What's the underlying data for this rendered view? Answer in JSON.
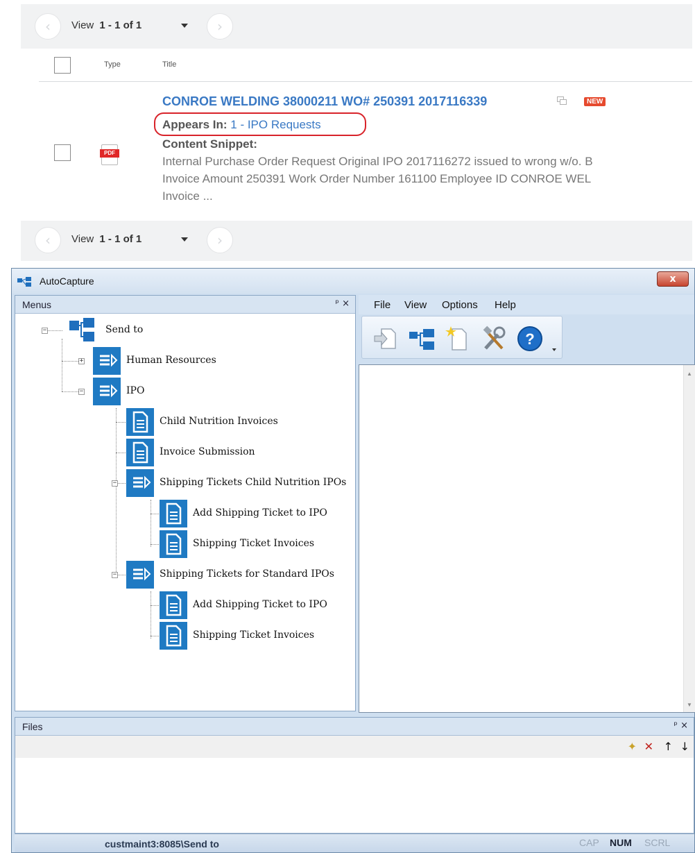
{
  "results": {
    "pager_top": {
      "view_label": "View",
      "range": "1 - 1 of 1",
      "prev": "‹",
      "next": "›"
    },
    "pager_bottom": {
      "view_label": "View",
      "range": "1 - 1 of 1",
      "prev": "‹",
      "next": "›"
    },
    "columns": {
      "type": "Type",
      "title": "Title"
    },
    "row": {
      "type_icon": "pdf-icon",
      "pdf_tag": "PDF",
      "title": "CONROE WELDING 38000211 WO# 250391 2017116339",
      "badge": "NEW",
      "appears_in_label": "Appears In:",
      "appears_in_value": "1 - IPO Requests",
      "snippet_label": "Content Snippet:",
      "snippet_lines": [
        "Internal Purchase Order Request Original IPO 2017116272 issued to wrong w/o. B",
        "Invoice Amount 250391 Work Order Number 161100 Employee ID CONROE WEL",
        "Invoice ..."
      ]
    }
  },
  "window": {
    "title": "AutoCapture",
    "close": "x",
    "menus_pane": {
      "label": "Menus",
      "controls": "ᵖ ×",
      "tree": {
        "root": "Send to",
        "human_resources": "Human Resources",
        "ipo": "IPO",
        "child_nutrition_invoices": "Child Nutrition Invoices",
        "invoice_submission": "Invoice Submission",
        "shipping_child": "Shipping Tickets Child Nutrition IPOs",
        "add_ticket_1": "Add Shipping Ticket to IPO",
        "ticket_invoices_1": "Shipping Ticket Invoices",
        "shipping_standard": "Shipping Tickets for Standard IPOs",
        "add_ticket_2": "Add Shipping Ticket to IPO",
        "ticket_invoices_2": "Shipping Ticket Invoices"
      }
    },
    "menubar": [
      "File",
      "View",
      "Options",
      "Help"
    ],
    "files_pane": {
      "label": "Files",
      "controls": "ᵖ ×"
    },
    "status": {
      "path": "custmaint3:8085\\Send to",
      "cap": "CAP",
      "num": "NUM",
      "scrl": "SCRL"
    },
    "colors": {
      "accent": "#1f7ac3",
      "link": "#3a79c4",
      "highlight_ring": "#d8232a",
      "new_badge": "#e64a2e"
    }
  }
}
